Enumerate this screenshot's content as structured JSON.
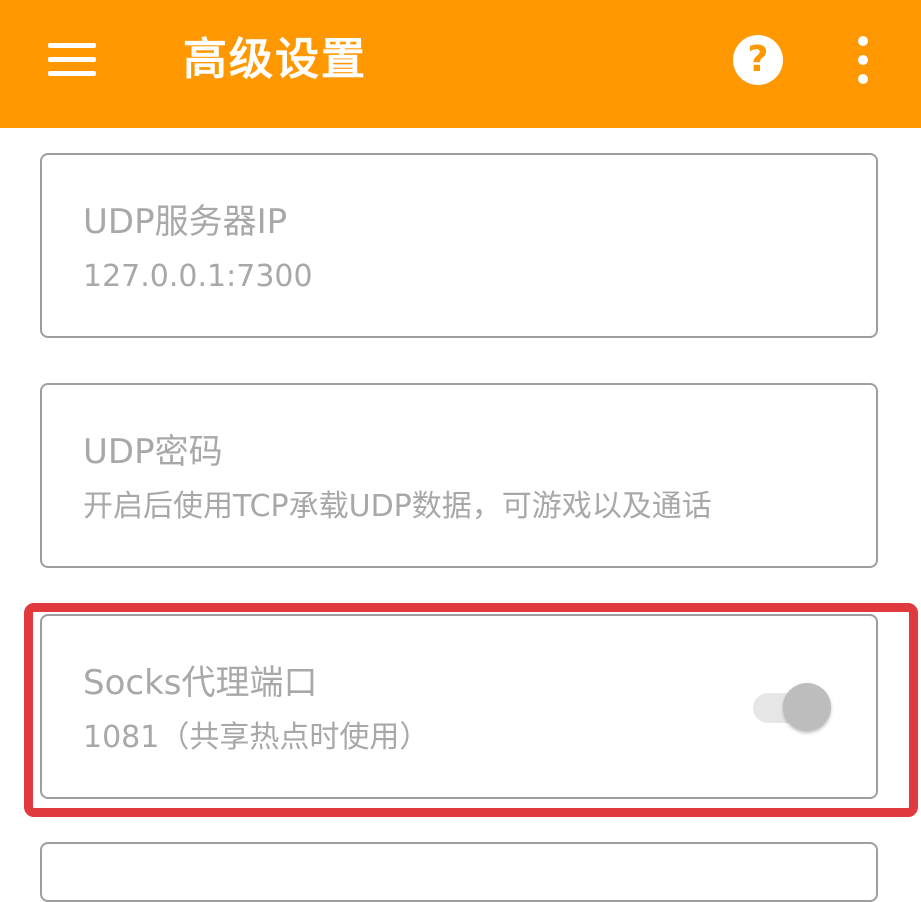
{
  "appbar": {
    "title": "高级设置",
    "menu_icon": "hamburger-menu-icon",
    "help_icon": "help-circle-icon",
    "help_glyph": "?",
    "more_icon": "more-vertical-icon",
    "color": "#FF9800"
  },
  "settings": [
    {
      "title": "UDP服务器IP",
      "summary": "127.0.0.1:7300"
    },
    {
      "title": "UDP密码",
      "summary": "开启后使用TCP承载UDP数据，可游戏以及通话"
    },
    {
      "title": "Socks代理端口",
      "summary": "1081（共享热点时使用）",
      "toggle": {
        "checked": false,
        "enabled": false
      }
    }
  ],
  "highlight_color": "#E0393E"
}
